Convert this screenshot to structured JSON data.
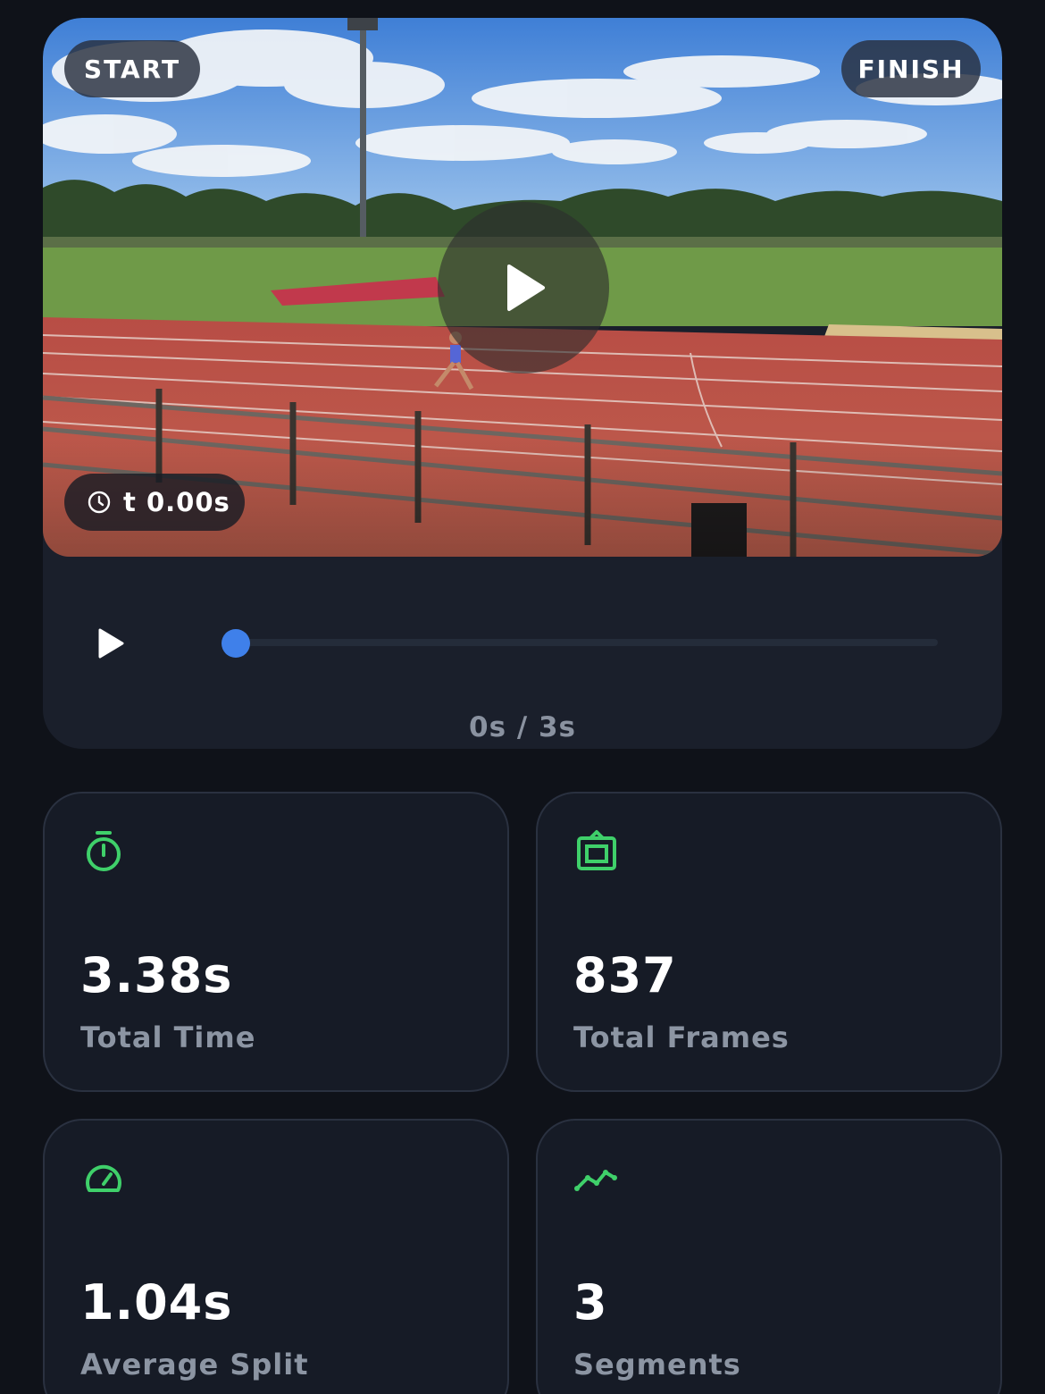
{
  "video": {
    "start_label": "START",
    "finish_label": "FINISH",
    "timestamp": "t 0.00s",
    "center_play_icon": "play-icon"
  },
  "controls": {
    "play_icon": "play-icon",
    "progress": 0,
    "time_readout": "0s / 3s"
  },
  "stats": [
    {
      "icon": "stopwatch-icon",
      "value": "3.38s",
      "label": "Total Time"
    },
    {
      "icon": "frame-icon",
      "value": "837",
      "label": "Total Frames"
    },
    {
      "icon": "speedometer-icon",
      "value": "1.04s",
      "label": "Average Split"
    },
    {
      "icon": "trend-line-icon",
      "value": "3",
      "label": "Segments"
    }
  ],
  "colors": {
    "background": "#0f1219",
    "card": "#161b26",
    "accent_green": "#3fd06a",
    "accent_blue": "#3f80ea",
    "muted_text": "#8c95a3"
  }
}
